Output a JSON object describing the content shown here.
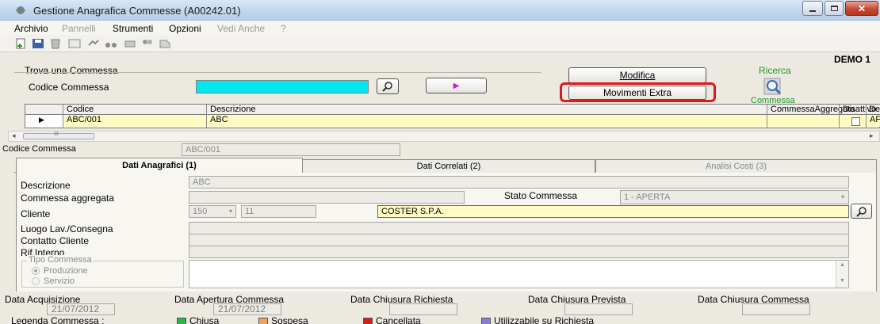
{
  "window": {
    "title": "Gestione Anagrafica Commesse  (A00242.01)",
    "company": "DEMO 1"
  },
  "menu": {
    "items": [
      "Archivio",
      "Pannelli",
      "Strumenti",
      "Opzioni",
      "Vedi Anche",
      "?"
    ]
  },
  "search": {
    "group_label": "Trova una Commessa",
    "code_label": "Codice Commessa",
    "code_value": "",
    "go_arrow": "▶"
  },
  "buttons": {
    "modifica": "Modifica",
    "movimenti_extra": "Movimenti Extra"
  },
  "ricerca": {
    "top": "Ricerca",
    "bottom": "Commessa"
  },
  "grid": {
    "columns": [
      "Codice",
      "Descrizione",
      "CommessaAggregata",
      "Disattivo",
      "De"
    ],
    "row": {
      "indicator": "▶",
      "codice": "ABC/001",
      "descrizione": "ABC",
      "aggregata": "",
      "last": "AF"
    },
    "scroll_mid": "III"
  },
  "detail": {
    "codice_label": "Codice Commessa",
    "codice_value": "ABC/001",
    "tabs": [
      "Dati Anagrafici (1)",
      "Dati Correlati (2)",
      "Analisi Costi (3)"
    ]
  },
  "form": {
    "descrizione_label": "Descrizione",
    "descrizione_value": "ABC",
    "aggregata_label": "Commessa aggregata",
    "stato_label": "Stato Commessa",
    "stato_value": "1 - APERTA",
    "cliente_label": "Cliente",
    "cliente_code": "150",
    "cliente_sub": "11",
    "cliente_name": "COSTER S.P.A.",
    "luogo_label": "Luogo Lav./Consegna",
    "contatto_label": "Contatto Cliente",
    "rif_label": "Rif.Interno",
    "tipo_label": "Tipo Commessa",
    "tipo_options": [
      "Produzione",
      "Servizio"
    ],
    "dates": [
      {
        "label": "Data Acquisizione",
        "value": "21/07/2012"
      },
      {
        "label": "Data Apertura Commessa",
        "value": "21/07/2012"
      },
      {
        "label": "Data Chiusura Richiesta",
        "value": ""
      },
      {
        "label": "Data Chiusura Prevista",
        "value": ""
      },
      {
        "label": "Data Chiusura Commessa",
        "value": ""
      }
    ]
  },
  "legend": {
    "label": "Legenda Commessa :",
    "items": [
      {
        "text": "Chiusa",
        "color": "#2db54a"
      },
      {
        "text": "Sospesa",
        "color": "#f2a35a"
      },
      {
        "text": "Cancellata",
        "color": "#d81b1b"
      },
      {
        "text": "Utilizzabile su Richiesta",
        "color": "#8a7cd4"
      }
    ]
  },
  "colors": {
    "cyan_field": "#00e8ee",
    "row_yellow": "#fffbc2",
    "highlight_red": "#e0171d",
    "ricerca_green": "#1c9b2a"
  }
}
